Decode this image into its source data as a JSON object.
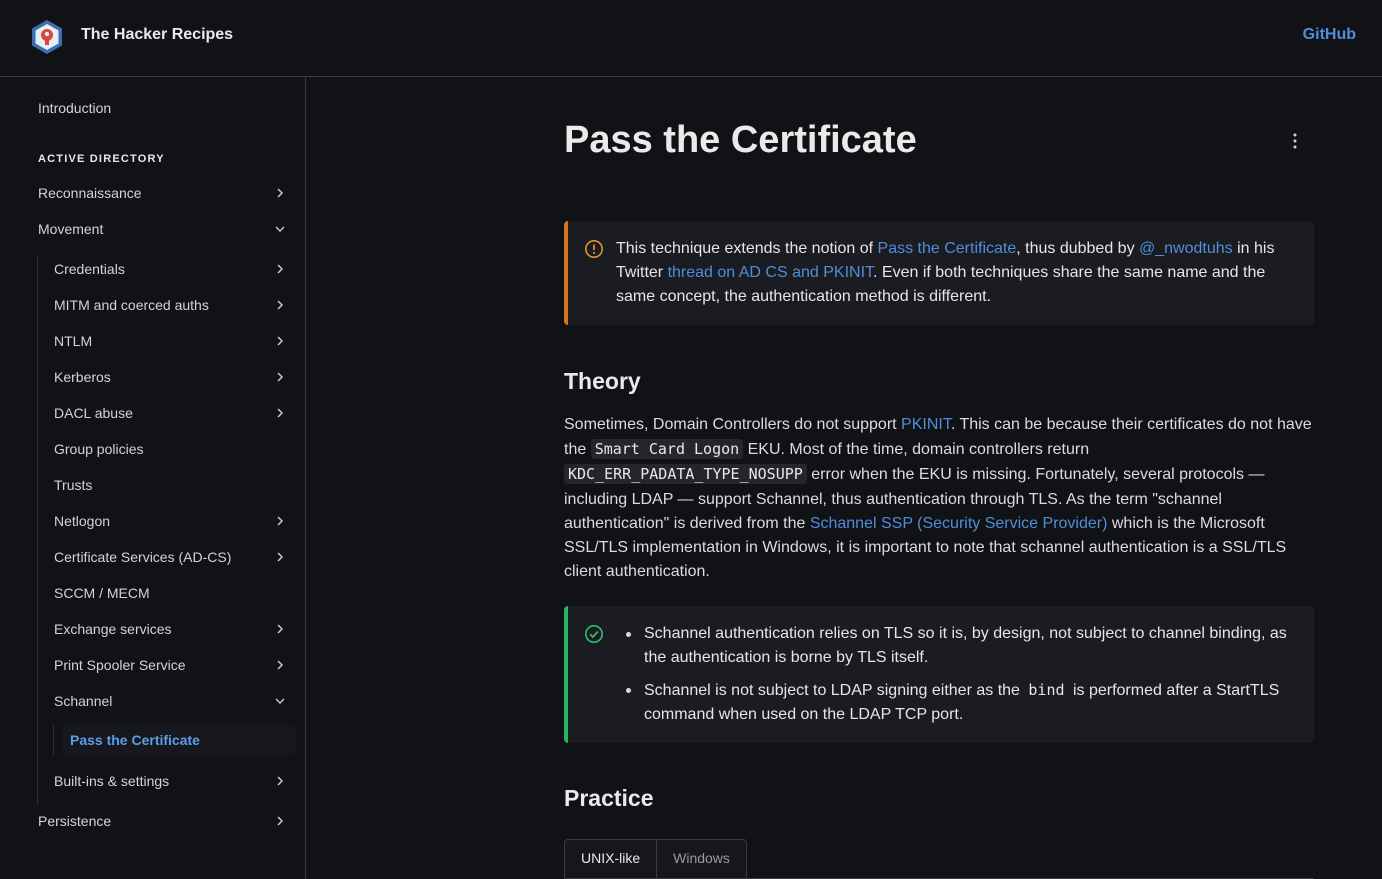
{
  "header": {
    "site_title": "The Hacker Recipes",
    "github_label": "GitHub"
  },
  "sidebar": {
    "intro": "Introduction",
    "section": "ACTIVE DIRECTORY",
    "reconnaissance": "Reconnaissance",
    "movement": "Movement",
    "sub": {
      "credentials": "Credentials",
      "mitm": "MITM and coerced auths",
      "ntlm": "NTLM",
      "kerberos": "Kerberos",
      "dacl": "DACL abuse",
      "gpo": "Group policies",
      "trusts": "Trusts",
      "netlogon": "Netlogon",
      "adcs": "Certificate Services (AD-CS)",
      "sccm": "SCCM / MECM",
      "exchange": "Exchange services",
      "spooler": "Print Spooler Service",
      "schannel": "Schannel",
      "ptc": "Pass the Certificate",
      "builtins": "Built-ins & settings"
    },
    "persistence": "Persistence"
  },
  "page": {
    "title": "Pass the Certificate",
    "warn": {
      "t1": "This technique extends the notion of ",
      "l1": "Pass the Certificate",
      "t2": ", thus dubbed by ",
      "l2": "@_nwodtuhs",
      "t3": " in his Twitter ",
      "l3": "thread on AD CS and PKINIT",
      "t4": ". Even if both techniques share the same name and the same concept, the authentication method is different."
    },
    "theory_heading": "Theory",
    "theory": {
      "t1": "Sometimes, Domain Controllers do not support ",
      "l1": "PKINIT",
      "t2": ". This can be because their certificates do not have the ",
      "c1": "Smart Card Logon",
      "t3": " EKU. Most of the time, domain controllers return ",
      "c2": "KDC_ERR_PADATA_TYPE_NOSUPP",
      "t4": " error when the EKU is missing. Fortunately, several protocols — including LDAP — support Schannel, thus authentication through TLS. As the term \"schannel authentication\" is derived from the ",
      "l2": "Schannel SSP (Security Service Provider)",
      "t5": " which is the Microsoft SSL/TLS implementation in Windows, it is important to note that schannel authentication is a SSL/TLS client authentication."
    },
    "tip": {
      "b1": "Schannel authentication relies on TLS so it is, by design, not subject to channel binding, as the authentication is borne by TLS itself.",
      "b2a": "Schannel is not subject to LDAP signing either as the ",
      "b2code": "bind",
      "b2b": " is performed after a StartTLS command when used on the LDAP TCP port."
    },
    "practice_heading": "Practice",
    "tabs": [
      "UNIX-like",
      "Windows"
    ]
  }
}
